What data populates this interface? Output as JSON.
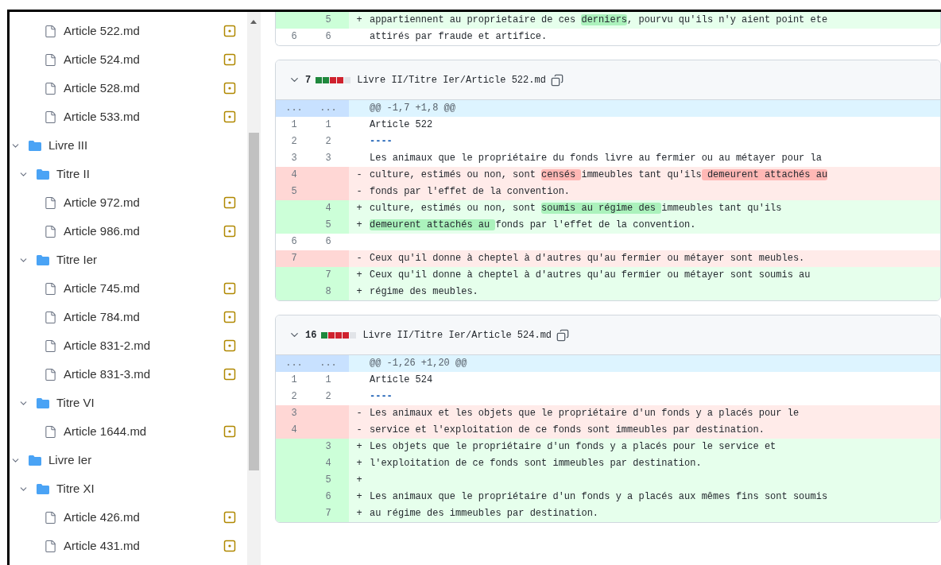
{
  "tree": [
    {
      "kind": "continued",
      "children": [
        {
          "kind": "continued",
          "children": [
            {
              "kind": "file",
              "name": "Article 522.md",
              "modified": true
            },
            {
              "kind": "file",
              "name": "Article 524.md",
              "modified": true
            },
            {
              "kind": "file",
              "name": "Article 528.md",
              "modified": true
            },
            {
              "kind": "file",
              "name": "Article 533.md",
              "modified": true
            }
          ]
        }
      ]
    },
    {
      "kind": "folder",
      "name": "Livre III",
      "expanded": true,
      "children": [
        {
          "kind": "folder",
          "name": "Titre II",
          "expanded": true,
          "children": [
            {
              "kind": "file",
              "name": "Article 972.md",
              "modified": true
            },
            {
              "kind": "file",
              "name": "Article 986.md",
              "modified": true
            }
          ]
        },
        {
          "kind": "folder",
          "name": "Titre Ier",
          "expanded": true,
          "children": [
            {
              "kind": "file",
              "name": "Article 745.md",
              "modified": true
            },
            {
              "kind": "file",
              "name": "Article 784.md",
              "modified": true
            },
            {
              "kind": "file",
              "name": "Article 831-2.md",
              "modified": true
            },
            {
              "kind": "file",
              "name": "Article 831-3.md",
              "modified": true
            }
          ]
        },
        {
          "kind": "folder",
          "name": "Titre VI",
          "expanded": true,
          "children": [
            {
              "kind": "file",
              "name": "Article 1644.md",
              "modified": true
            }
          ]
        }
      ]
    },
    {
      "kind": "folder",
      "name": "Livre Ier",
      "expanded": true,
      "children": [
        {
          "kind": "folder",
          "name": "Titre XI",
          "expanded": true,
          "children": [
            {
              "kind": "file",
              "name": "Article 426.md",
              "modified": true
            },
            {
              "kind": "file",
              "name": "Article 431.md",
              "modified": true
            }
          ]
        }
      ]
    }
  ],
  "diffs": [
    {
      "lines": [
        {
          "kind": "added",
          "new": "5",
          "sign": "+",
          "segments": [
            {
              "text": "appartiennent au proprietaire de ces "
            },
            {
              "text": "derniers",
              "highlight": true
            },
            {
              "text": ", pourvu qu'ils n'y aient point ete"
            }
          ]
        },
        {
          "kind": "context",
          "old": "6",
          "new": "6",
          "segments": [
            {
              "text": "attirés par fraude et artifice."
            }
          ]
        }
      ]
    },
    {
      "header": {
        "expanded": true,
        "count": "7",
        "stats": [
          {
            "kind": "added"
          },
          {
            "kind": "added"
          },
          {
            "kind": "deleted"
          },
          {
            "kind": "deleted"
          },
          {
            "kind": "neutral"
          }
        ],
        "path": "Livre II/Titre Ier/Article 522.md"
      },
      "lines": [
        {
          "kind": "hunk",
          "old": "...",
          "new": "...",
          "segments": [
            {
              "text": "@@ -1,7 +1,8 @@"
            }
          ]
        },
        {
          "kind": "context",
          "old": "1",
          "new": "1",
          "segments": [
            {
              "text": "Article 522"
            }
          ]
        },
        {
          "kind": "context",
          "old": "2",
          "new": "2",
          "segments": [
            {
              "kind": "rule",
              "text": "----"
            }
          ]
        },
        {
          "kind": "context",
          "old": "3",
          "new": "3",
          "segments": [
            {
              "text": "Les animaux que le propriétaire du fonds livre au fermier ou au métayer pour la"
            }
          ]
        },
        {
          "kind": "deleted",
          "old": "4",
          "sign": "-",
          "segments": [
            {
              "text": "culture, estimés ou non, sont "
            },
            {
              "text": "censés ",
              "highlight": true
            },
            {
              "text": "immeubles tant qu'ils"
            },
            {
              "text": " demeurent attachés au",
              "highlight": true
            }
          ]
        },
        {
          "kind": "deleted",
          "old": "5",
          "sign": "-",
          "segments": [
            {
              "text": "fonds par l'effet de la convention."
            }
          ]
        },
        {
          "kind": "added",
          "new": "4",
          "sign": "+",
          "segments": [
            {
              "text": "culture, estimés ou non, sont "
            },
            {
              "text": "soumis au régime des ",
              "highlight": true
            },
            {
              "text": "immeubles tant qu'ils"
            }
          ]
        },
        {
          "kind": "added",
          "new": "5",
          "sign": "+",
          "segments": [
            {
              "text": "demeurent attachés au ",
              "highlight": true
            },
            {
              "text": "fonds par l'effet de la convention."
            }
          ]
        },
        {
          "kind": "context",
          "old": "6",
          "new": "6"
        },
        {
          "kind": "deleted",
          "old": "7",
          "sign": "-",
          "segments": [
            {
              "text": "Ceux qu'il donne à cheptel à d'autres qu'au fermier ou métayer sont meubles."
            }
          ]
        },
        {
          "kind": "added",
          "new": "7",
          "sign": "+",
          "segments": [
            {
              "text": "Ceux qu'il donne à cheptel à d'autres qu'au fermier ou métayer sont soumis au"
            }
          ]
        },
        {
          "kind": "added",
          "new": "8",
          "sign": "+",
          "segments": [
            {
              "text": "régime des meubles."
            }
          ]
        }
      ]
    },
    {
      "header": {
        "expanded": true,
        "count": "16",
        "stats": [
          {
            "kind": "added"
          },
          {
            "kind": "deleted"
          },
          {
            "kind": "deleted"
          },
          {
            "kind": "deleted"
          },
          {
            "kind": "neutral"
          }
        ],
        "path": "Livre II/Titre Ier/Article 524.md"
      },
      "lines": [
        {
          "kind": "hunk",
          "old": "...",
          "new": "...",
          "segments": [
            {
              "text": "@@ -1,26 +1,20 @@"
            }
          ]
        },
        {
          "kind": "context",
          "old": "1",
          "new": "1",
          "segments": [
            {
              "text": "Article 524"
            }
          ]
        },
        {
          "kind": "context",
          "old": "2",
          "new": "2",
          "segments": [
            {
              "kind": "rule",
              "text": "----"
            }
          ]
        },
        {
          "kind": "deleted",
          "old": "3",
          "sign": "-",
          "segments": [
            {
              "text": "Les animaux et les objets que le propriétaire d'un fonds y a placés pour le"
            }
          ]
        },
        {
          "kind": "deleted",
          "old": "4",
          "sign": "-",
          "segments": [
            {
              "text": "service et l'exploitation de ce fonds sont immeubles par destination."
            }
          ]
        },
        {
          "kind": "added",
          "new": "3",
          "sign": "+",
          "segments": [
            {
              "text": "Les objets que le propriétaire d'un fonds y a placés pour le service et"
            }
          ]
        },
        {
          "kind": "added",
          "new": "4",
          "sign": "+",
          "segments": [
            {
              "text": "l'exploitation de ce fonds sont immeubles par destination."
            }
          ]
        },
        {
          "kind": "added",
          "new": "5",
          "sign": "+"
        },
        {
          "kind": "added",
          "new": "6",
          "sign": "+",
          "segments": [
            {
              "text": "Les animaux que le propriétaire d'un fonds y a placés aux mêmes fins sont soumis"
            }
          ]
        },
        {
          "kind": "added",
          "new": "7",
          "sign": "+",
          "segments": [
            {
              "text": "au régime des immeubles par destination."
            }
          ]
        }
      ]
    }
  ]
}
